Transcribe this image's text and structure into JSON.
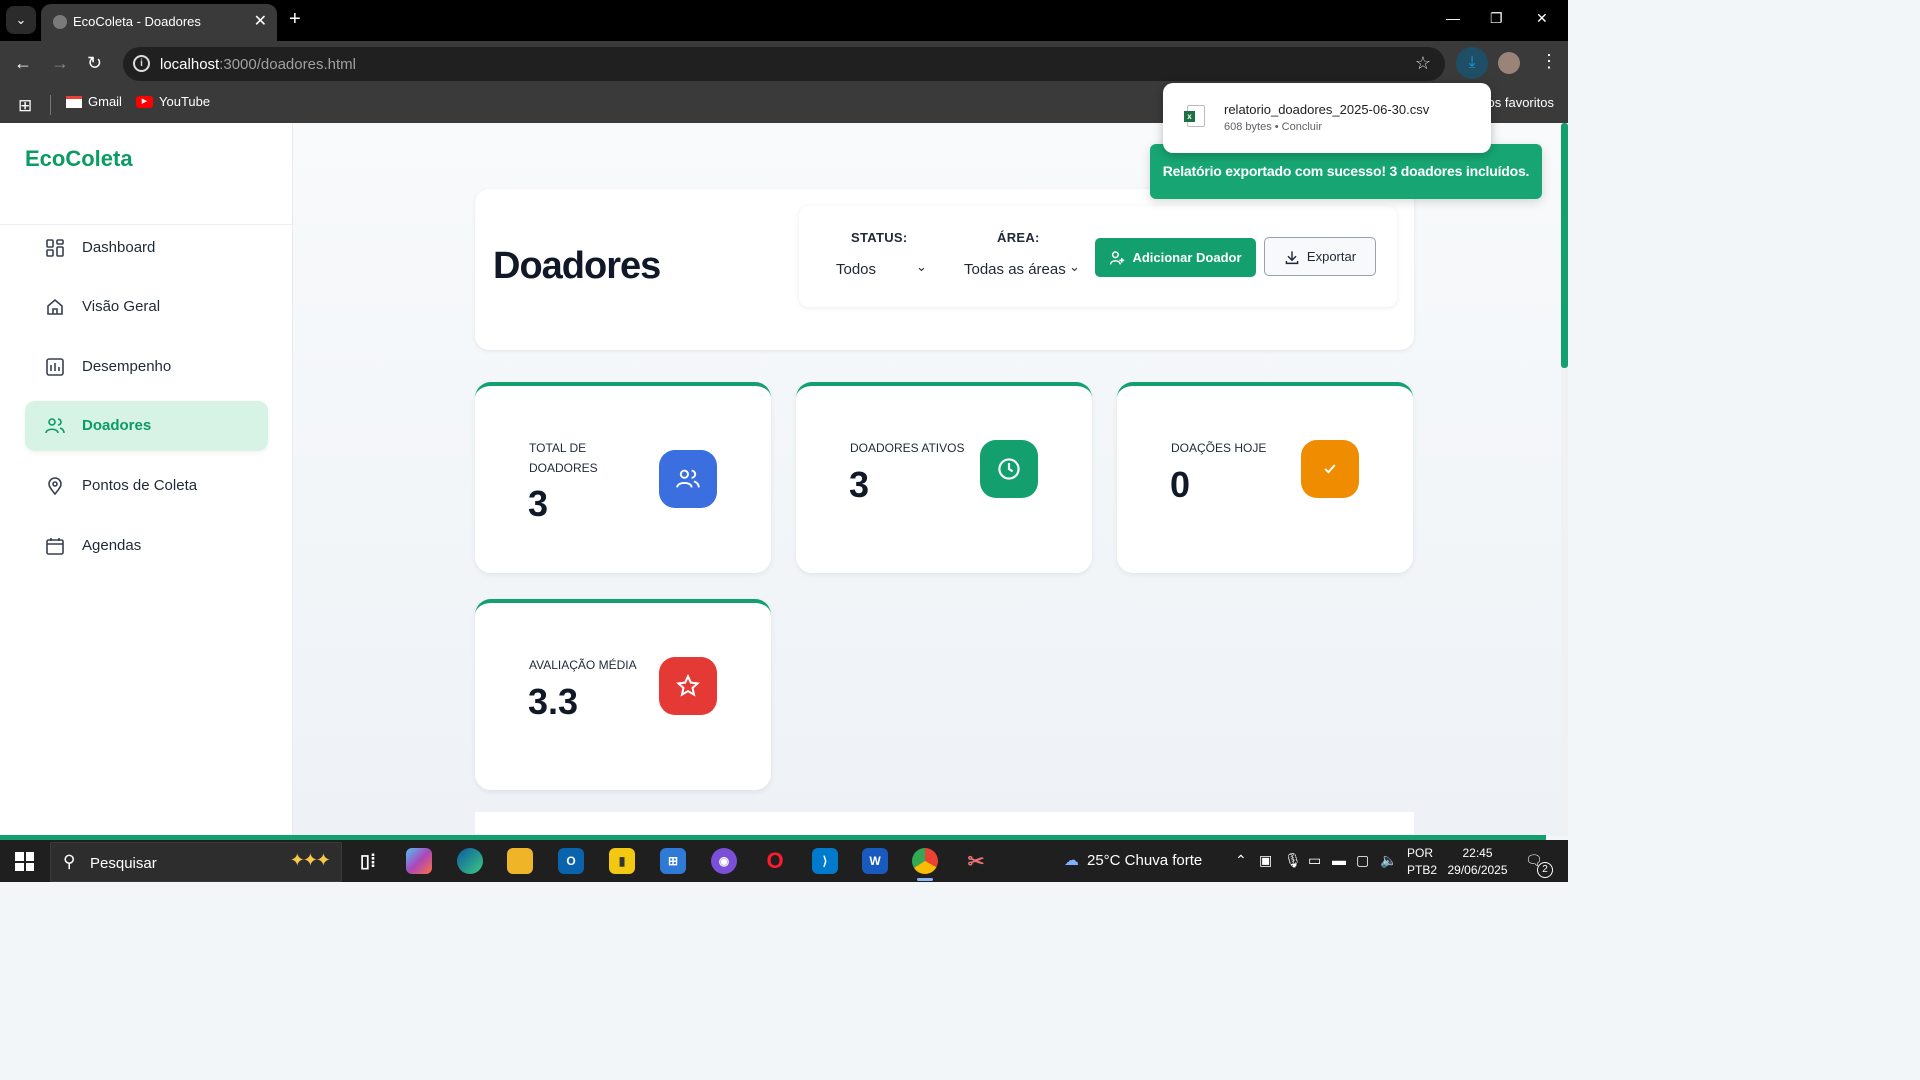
{
  "browser": {
    "tab_title": "EcoColeta - Doadores",
    "tab_close": "✕",
    "new_tab": "+",
    "url_host": "localhost",
    "url_path": ":3000/doadores.html",
    "bookmarks": [
      {
        "label": "Gmail",
        "icon": "gmail-icon"
      },
      {
        "label": "YouTube",
        "icon": "youtube-icon"
      }
    ],
    "bookmarks_right": "os favoritos"
  },
  "download": {
    "file_name": "relatorio_doadores_2025-06-30.csv",
    "meta": "608 bytes • Concluir"
  },
  "toast": {
    "message": "Relatório exportado com sucesso! 3 doadores incluídos."
  },
  "sidebar": {
    "brand": "EcoColeta",
    "items": [
      {
        "label": "Dashboard",
        "icon": "dashboard-icon",
        "active": false
      },
      {
        "label": "Visão Geral",
        "icon": "home-icon",
        "active": false
      },
      {
        "label": "Desempenho",
        "icon": "chart-icon",
        "active": false
      },
      {
        "label": "Doadores",
        "icon": "users-icon",
        "active": true
      },
      {
        "label": "Pontos de Coleta",
        "icon": "map-pin-icon",
        "active": false
      },
      {
        "label": "Agendas",
        "icon": "calendar-icon",
        "active": false
      }
    ]
  },
  "header": {
    "title": "Doadores",
    "status_label": "STATUS:",
    "status_value": "Todos",
    "area_label": "ÁREA:",
    "area_value": "Todas as áreas",
    "add_button": "Adicionar Doador",
    "export_button": "Exportar"
  },
  "stats": [
    {
      "label": "TOTAL DE DOADORES",
      "value": "3",
      "icon": "users-icon",
      "color": "#3b6fe0"
    },
    {
      "label": "DOADORES ATIVOS",
      "value": "3",
      "icon": "clock-icon",
      "color": "#13a06e"
    },
    {
      "label": "DOAÇÕES HOJE",
      "value": "0",
      "icon": "check-icon",
      "color": "#f08c00"
    },
    {
      "label": "AVALIAÇÃO MÉDIA",
      "value": "3.3",
      "icon": "star-icon",
      "color": "#e53935"
    }
  ],
  "colors": {
    "accent": "#13a06e",
    "brand": "#0b9b64"
  },
  "taskbar": {
    "search_placeholder": "Pesquisar",
    "weather": "25°C  Chuva forte",
    "lang_1": "POR",
    "lang_2": "PTB2",
    "time": "22:45",
    "date": "29/06/2025",
    "notifications": "2"
  }
}
